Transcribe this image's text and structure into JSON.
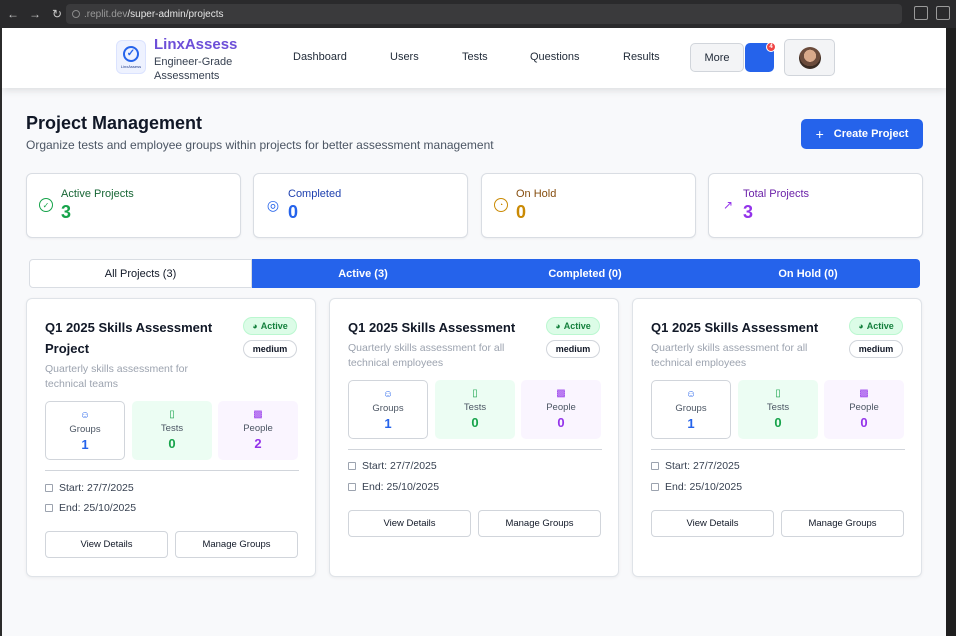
{
  "browser": {
    "url_prefix": ".replit.dev",
    "url_path": "/super-admin/projects"
  },
  "header": {
    "brand_name": "LinxAssess",
    "brand_sub": "Engineer-Grade Assessments",
    "logo_text": "LinxAssess",
    "nav": [
      "Dashboard",
      "Users",
      "Tests",
      "Questions",
      "Results"
    ],
    "more_label": "More",
    "notification_count": "4"
  },
  "page": {
    "title": "Project Management",
    "subtitle": "Organize tests and employee groups within projects for better assessment management",
    "create_label": "Create Project"
  },
  "stats": [
    {
      "label": "Active Projects",
      "value": "3",
      "color": "#16a34a",
      "icon": "check-circle-icon"
    },
    {
      "label": "Completed",
      "value": "0",
      "color": "#2563eb",
      "icon": "target-icon"
    },
    {
      "label": "On Hold",
      "value": "0",
      "color": "#ca8a04",
      "icon": "clock-icon"
    },
    {
      "label": "Total Projects",
      "value": "3",
      "color": "#9333ea",
      "icon": "trending-up-icon"
    }
  ],
  "tabs": [
    "All Projects (3)",
    "Active (3)",
    "Completed (0)",
    "On Hold (0)"
  ],
  "projects": [
    {
      "title": "Q1 2025 Skills Assessment Project",
      "description": "Quarterly skills assessment for technical teams",
      "status": "Active",
      "priority": "medium",
      "groups_label": "Groups",
      "groups": "1",
      "tests_label": "Tests",
      "tests": "0",
      "people_label": "People",
      "people": "2",
      "start": "Start: 27/7/2025",
      "end": "End: 25/10/2025",
      "view_label": "View Details",
      "manage_label": "Manage Groups"
    },
    {
      "title": "Q1 2025 Skills Assessment",
      "description": "Quarterly skills assessment for all technical employees",
      "status": "Active",
      "priority": "medium",
      "groups_label": "Groups",
      "groups": "1",
      "tests_label": "Tests",
      "tests": "0",
      "people_label": "People",
      "people": "0",
      "start": "Start: 27/7/2025",
      "end": "End: 25/10/2025",
      "view_label": "View Details",
      "manage_label": "Manage Groups"
    },
    {
      "title": "Q1 2025 Skills Assessment",
      "description": "Quarterly skills assessment for all technical employees",
      "status": "Active",
      "priority": "medium",
      "groups_label": "Groups",
      "groups": "1",
      "tests_label": "Tests",
      "tests": "0",
      "people_label": "People",
      "people": "0",
      "start": "Start: 27/7/2025",
      "end": "End: 25/10/2025",
      "view_label": "View Details",
      "manage_label": "Manage Groups"
    }
  ]
}
